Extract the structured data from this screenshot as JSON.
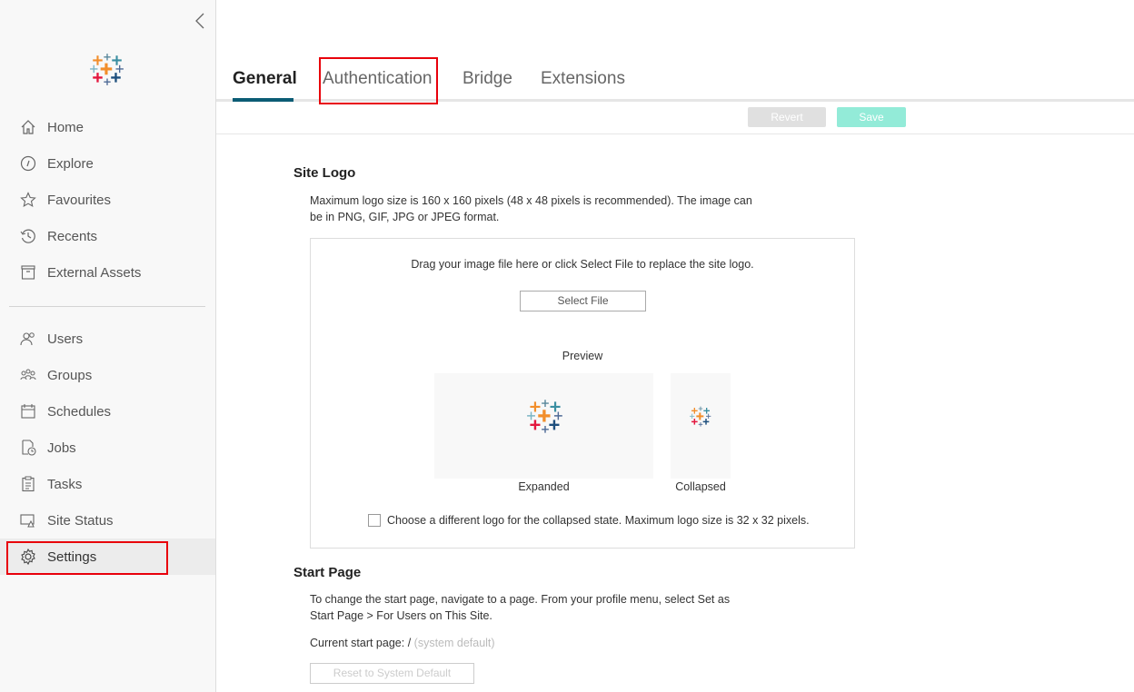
{
  "sidebar": {
    "collapse_icon": "chevron-left-icon",
    "items": [
      {
        "label": "Home",
        "icon": "home-icon"
      },
      {
        "label": "Explore",
        "icon": "compass-icon"
      },
      {
        "label": "Favourites",
        "icon": "star-icon"
      },
      {
        "label": "Recents",
        "icon": "history-icon"
      },
      {
        "label": "External Assets",
        "icon": "archive-icon"
      },
      {
        "label": "Users",
        "icon": "user-icon"
      },
      {
        "label": "Groups",
        "icon": "group-icon"
      },
      {
        "label": "Schedules",
        "icon": "calendar-icon"
      },
      {
        "label": "Jobs",
        "icon": "job-icon"
      },
      {
        "label": "Tasks",
        "icon": "clipboard-icon"
      },
      {
        "label": "Site Status",
        "icon": "status-icon"
      },
      {
        "label": "Settings",
        "icon": "gear-icon",
        "active": true
      }
    ]
  },
  "tabs": [
    {
      "label": "General",
      "active": true
    },
    {
      "label": "Authentication"
    },
    {
      "label": "Bridge"
    },
    {
      "label": "Extensions"
    }
  ],
  "toolbar": {
    "revert_label": "Revert",
    "save_label": "Save"
  },
  "site_logo": {
    "heading": "Site Logo",
    "description": "Maximum logo size is 160 x 160 pixels (48 x 48 pixels is recommended). The image can be in PNG, GIF, JPG or JPEG format.",
    "drop_text": "Drag your image file here or click Select File to replace the site logo.",
    "select_file_label": "Select File",
    "preview_label": "Preview",
    "expanded_label": "Expanded",
    "collapsed_label": "Collapsed",
    "checkbox_label": "Choose a different logo for the collapsed state. Maximum logo size is 32 x 32 pixels.",
    "checkbox_checked": false
  },
  "start_page": {
    "heading": "Start Page",
    "description": "To change the start page, navigate to a page. From your profile menu, select Set as Start Page > For Users on This Site.",
    "current_label": "Current start page: /",
    "current_value": "(system default)",
    "reset_label": "Reset to System Default"
  },
  "colors": {
    "accent": "#0b5c75",
    "save": "#93ebd8",
    "revert": "#e0e0e0",
    "highlight": "#e8000b"
  }
}
